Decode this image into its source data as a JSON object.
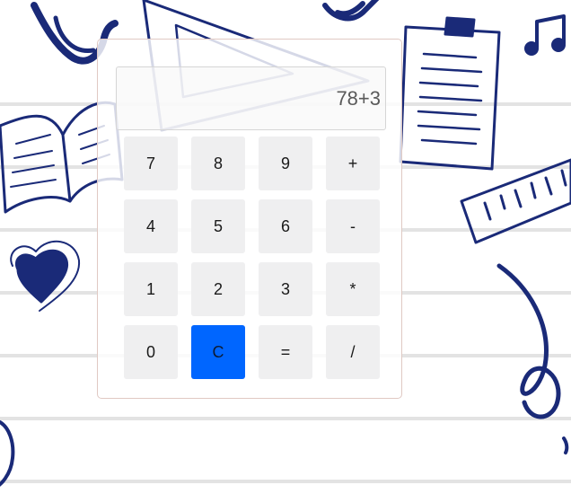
{
  "calculator": {
    "display_value": "78+3",
    "keys": [
      {
        "label": "7",
        "name": "key-7-button"
      },
      {
        "label": "8",
        "name": "key-8-button"
      },
      {
        "label": "9",
        "name": "key-9-button"
      },
      {
        "label": "+",
        "name": "key-plus-button"
      },
      {
        "label": "4",
        "name": "key-4-button"
      },
      {
        "label": "5",
        "name": "key-5-button"
      },
      {
        "label": "6",
        "name": "key-6-button"
      },
      {
        "label": "-",
        "name": "key-minus-button"
      },
      {
        "label": "1",
        "name": "key-1-button"
      },
      {
        "label": "2",
        "name": "key-2-button"
      },
      {
        "label": "3",
        "name": "key-3-button"
      },
      {
        "label": "*",
        "name": "key-multiply-button"
      },
      {
        "label": "0",
        "name": "key-0-button"
      },
      {
        "label": "C",
        "name": "clear-button"
      },
      {
        "label": "=",
        "name": "equals-button"
      },
      {
        "label": "/",
        "name": "key-divide-button"
      }
    ]
  },
  "background": {
    "doodles": [
      "worm-icon",
      "triangle-ruler-icon",
      "ink-blot-icon",
      "clipboard-icon",
      "music-note-icon",
      "open-book-icon",
      "heart-icon",
      "ruler-icon",
      "swirl-icon"
    ]
  },
  "colors": {
    "clear_key": "#0066ff",
    "key": "#efeff0",
    "doodle_ink": "#1a2a78",
    "paper_line": "#e3e3e3"
  }
}
